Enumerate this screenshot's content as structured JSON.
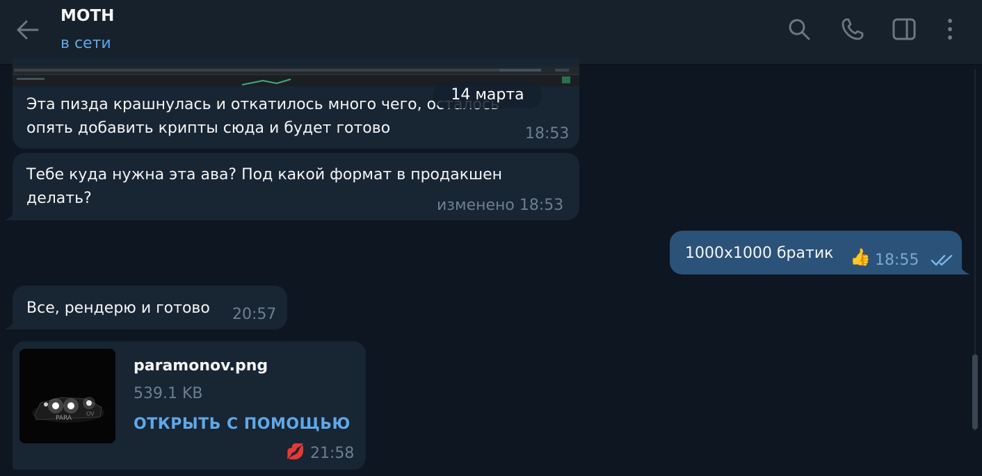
{
  "header": {
    "title": "МОТН",
    "status": "в сети",
    "icons": [
      "back-arrow-icon",
      "search-icon",
      "phone-icon",
      "sidebar-toggle-icon",
      "more-vertical-icon"
    ],
    "accent_color": "#5fa8e8"
  },
  "date_divider": "14 марта",
  "messages": [
    {
      "direction": "in",
      "text": "Эта пизда крашнулась и откатилось много чего, осталось\nопять добавить крипты сюда и будет готово",
      "time": "18:53"
    },
    {
      "direction": "in",
      "text": "Тебе куда нужна эта ава? Под какой формат в продакшен\nделать?",
      "edited_label": "изменено",
      "time": "18:53"
    },
    {
      "direction": "out",
      "text": "1000x1000 братик",
      "reaction": "👍",
      "time": "18:55",
      "status": "read"
    },
    {
      "direction": "in",
      "text": "Все, рендерю и готово",
      "time": "20:57"
    },
    {
      "direction": "in",
      "type": "file",
      "file_name": "paramonov.png",
      "file_size": "539.1 KB",
      "action_label": "ОТКРЫТЬ С ПОМОЩЬЮ",
      "reaction": "💋",
      "time": "21:58"
    }
  ],
  "colors": {
    "background": "#0e1621",
    "header": "#17212b",
    "incoming_bubble": "#182533",
    "outgoing_bubble": "#2b5278",
    "meta_text": "#6d7f8f",
    "link": "#5fa8e8"
  }
}
